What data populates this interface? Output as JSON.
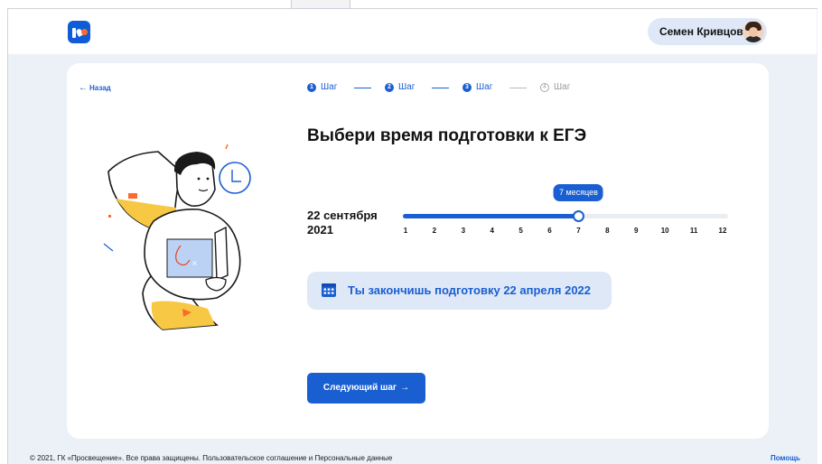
{
  "user": {
    "name": "Семен Кривцов"
  },
  "nav": {
    "back_label": "Назад"
  },
  "steps": [
    {
      "num": "1",
      "label": "Шаг",
      "state": "done"
    },
    {
      "num": "2",
      "label": "Шаг",
      "state": "done"
    },
    {
      "num": "3",
      "label": "Шаг",
      "state": "active"
    },
    {
      "num": "4",
      "label": "Шаг",
      "state": "pending"
    }
  ],
  "main": {
    "title": "Выбери время подготовки к ЕГЭ",
    "start_date_line1": "22 сентября",
    "start_date_line2": "2021"
  },
  "slider": {
    "min": 1,
    "max": 12,
    "value": 7,
    "ticks": [
      "1",
      "2",
      "3",
      "4",
      "5",
      "6",
      "7",
      "8",
      "9",
      "10",
      "11",
      "12"
    ],
    "tooltip": "7 месяцев"
  },
  "result": {
    "text": "Ты закончишь подготовку 22 апреля 2022"
  },
  "next_button": {
    "label": "Следующий шаг",
    "arrow": "→"
  },
  "footer": {
    "copyright": "© 2021, ГК «Просвещение». Все права защищены.",
    "agreement": "Пользовательское соглашение",
    "and": "и",
    "personal": "Персональные данные",
    "help": "Помощь"
  },
  "icons": {
    "logo": "brand-logo",
    "back": "arrow-left-icon",
    "calendar": "calendar-icon",
    "next": "arrow-right-icon",
    "clock": "clock-icon"
  },
  "colors": {
    "accent": "#1a5fd1",
    "page_bg": "#ecf1f8",
    "pill_bg": "#dfe8f7",
    "illus_yellow": "#f7c843",
    "illus_orange": "#ff6a2a"
  }
}
